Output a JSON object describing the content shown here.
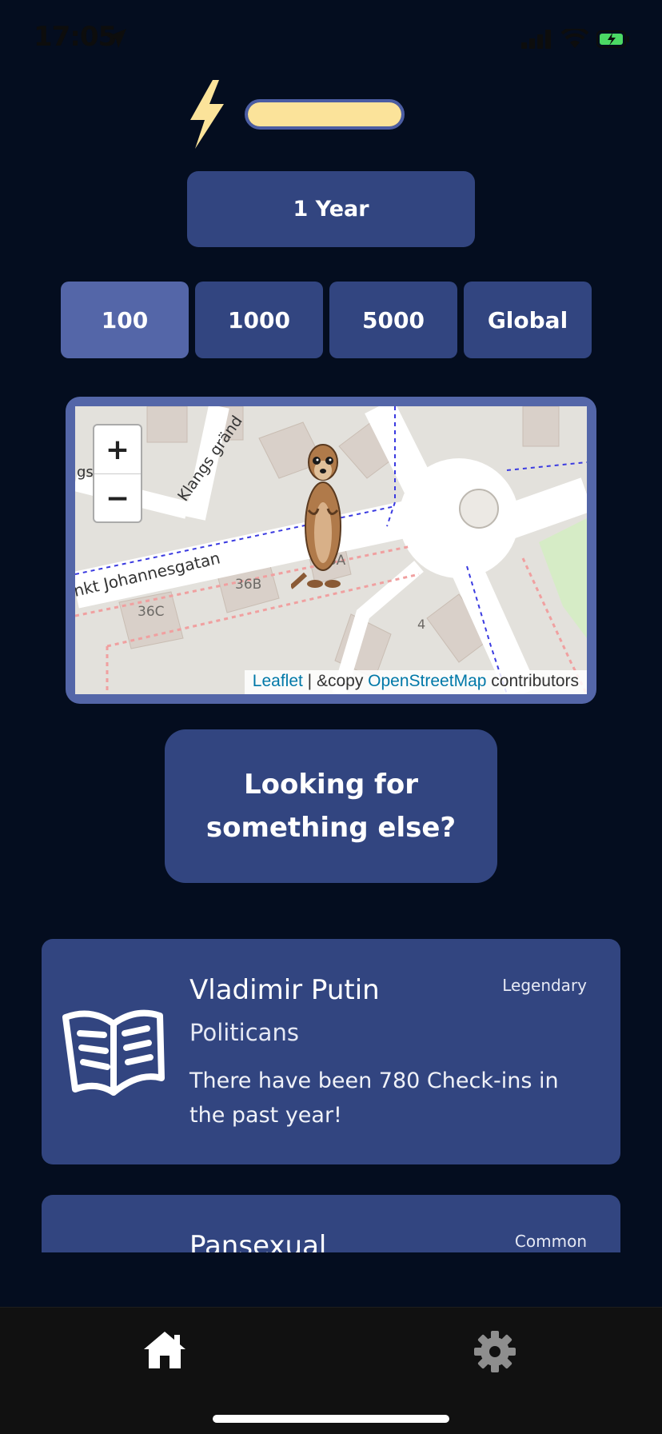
{
  "status_bar": {
    "time": "17:05"
  },
  "energy": {
    "level": 1.0,
    "fill_color": "#fbe39a",
    "icon": "lightning-bolt-icon"
  },
  "period": {
    "label": "1 Year"
  },
  "range_buttons": [
    {
      "label": "100",
      "active": true
    },
    {
      "label": "1000",
      "active": false
    },
    {
      "label": "5000",
      "active": false
    },
    {
      "label": "Global",
      "active": false
    }
  ],
  "map": {
    "zoom_in": "+",
    "zoom_out": "−",
    "attribution": {
      "leaflet": "Leaflet",
      "separator": " | &copy ",
      "osm": "OpenStreetMap",
      "contributors": " contributors"
    },
    "street_labels": [
      "Klangs gränd",
      "nkt Johannesgatan",
      "gs"
    ],
    "building_labels": [
      "36B",
      "36C",
      "36A",
      "4"
    ]
  },
  "cta": {
    "label": "Looking for something else?"
  },
  "cards": [
    {
      "title": "Vladimir Putin",
      "category": "Politicans",
      "description": "There have been 780 Check-ins in the past year!",
      "badge": "Legendary",
      "icon": "open-book-icon"
    },
    {
      "title": "Pansexual",
      "badge": "Common"
    }
  ],
  "tabbar": {
    "home_icon": "home-icon",
    "settings_icon": "gear-icon",
    "active": "home"
  },
  "colors": {
    "background": "#040d1f",
    "card": "#324580",
    "active_button": "#5466a8",
    "tabbar": "#111111"
  }
}
